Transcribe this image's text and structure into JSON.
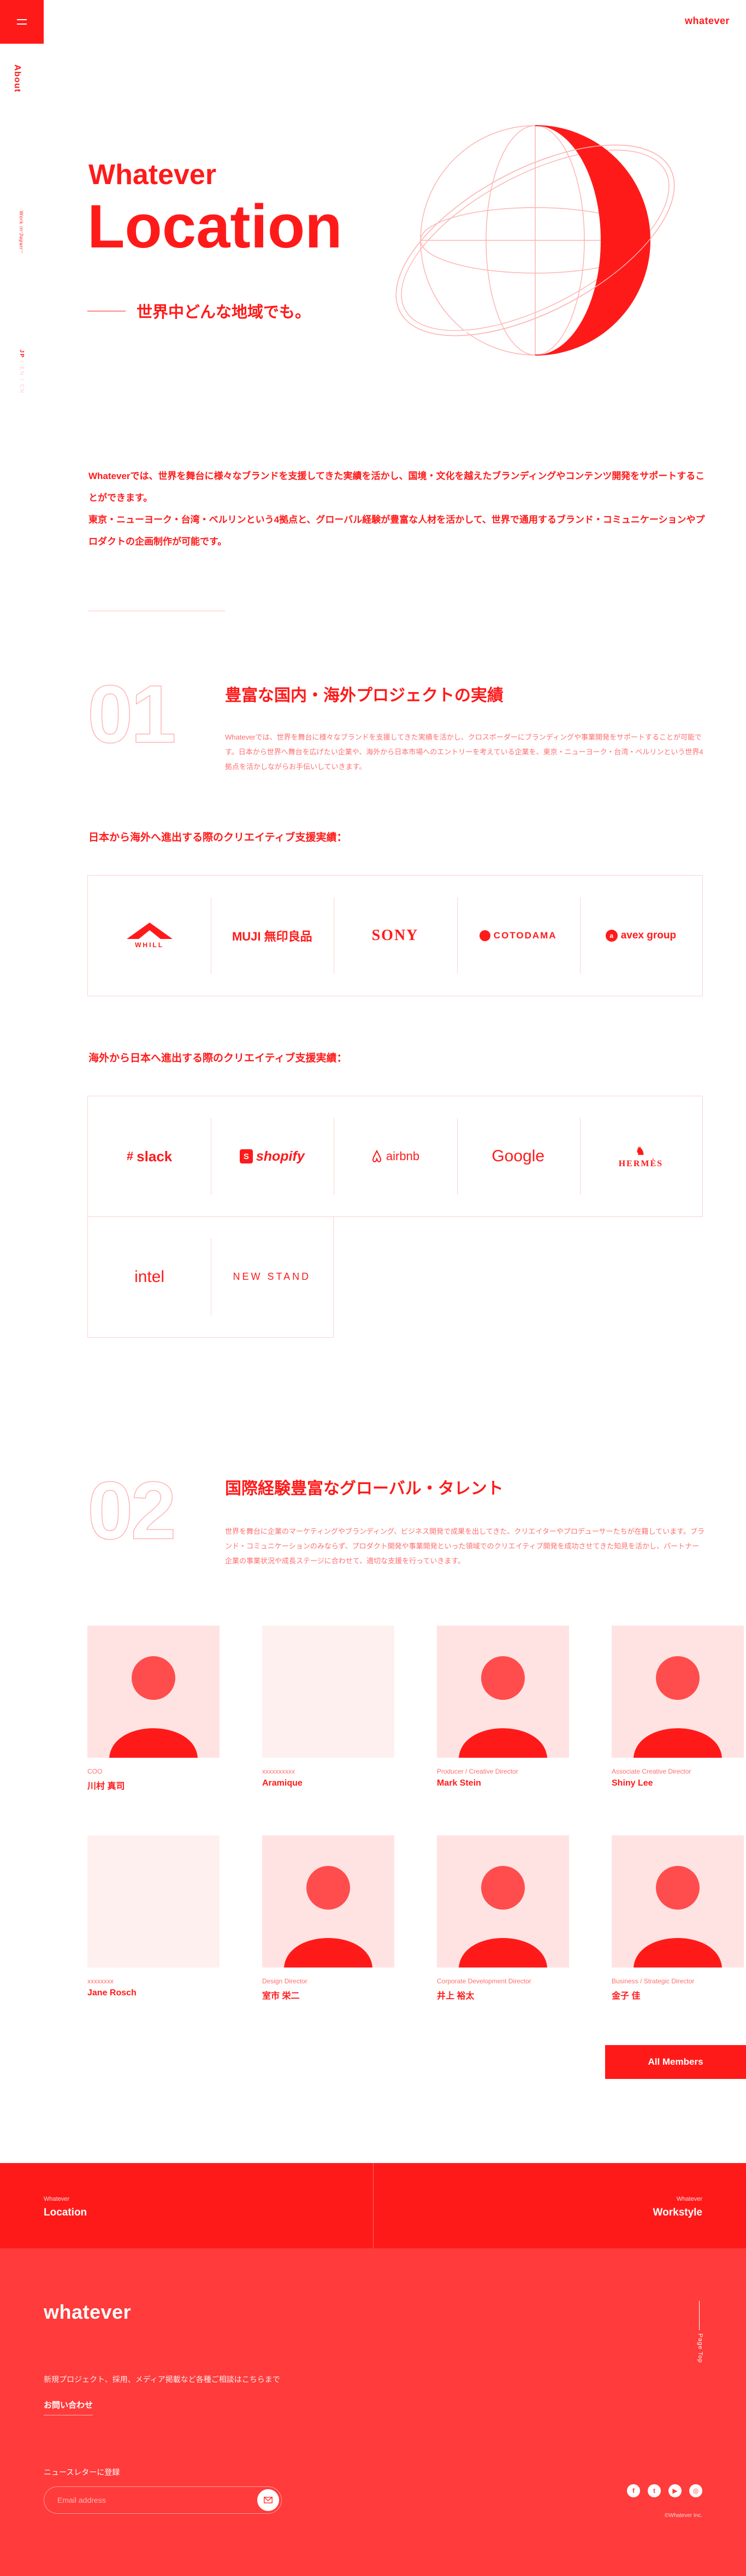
{
  "header": {
    "logo": "whatever",
    "menu_icon": "hamburger-icon"
  },
  "side": {
    "about": "About",
    "label": "Work in Japan",
    "lang": [
      "JP",
      "EN",
      "CN"
    ]
  },
  "hero": {
    "eyebrow": "Whatever",
    "title": "Location",
    "subtitle": "世界中どんな地域でも。"
  },
  "intro": {
    "line1": "Whateverでは、世界を舞台に様々なブランドを支援してきた実績を活かし、国境・文化を越えたブランディングやコンテンツ開発をサポートすることができます。",
    "line2": "東京・ニューヨーク・台湾・ベルリンという4拠点と、グローバル経験が豊富な人材を活かして、世界で通用するブランド・コミュニケーションやプロダクトの企画制作が可能です。"
  },
  "section1": {
    "num": "01",
    "title": "豊富な国内・海外プロジェクトの実績",
    "body": "Whateverでは、世界を舞台に様々なブランドを支援してきた実績を活かし、クロスボーダーにブランディングや事業開発をサポートすることが可能です。日本から世界へ舞台を広げたい企業や、海外から日本市場へのエントリーを考えている企業を、東京・ニューヨーク・台湾・ベルリンという世界4拠点を活かしながらお手伝いしていきます。",
    "jp_to_world_heading": "日本から海外へ進出する際のクリエイティブ支援実績：",
    "jp_to_world": [
      "WHILL",
      "MUJI 無印良品",
      "SONY",
      "COTODAMA",
      "avex group"
    ],
    "world_to_jp_heading": "海外から日本へ進出する際のクリエイティブ支援実績：",
    "world_to_jp": [
      "slack",
      "shopify",
      "airbnb",
      "Google",
      "HERMÈS",
      "intel",
      "NEW STAND"
    ]
  },
  "section2": {
    "num": "02",
    "title": "国際経験豊富なグローバル・タレント",
    "body": "世界を舞台に企業のマーケティングやブランディング、ビジネス開発で成果を出してきた、クリエイターやプロデューサーたちが在籍しています。ブランド・コミュニケーションのみならず、プロダクト開発や事業開発といった領域でのクリエイティブ開発を成功させてきた知見を活かし、パートナー企業の事業状況や成長ステージに合わせて、適切な支援を行っていきます。",
    "members": [
      {
        "role": "COO",
        "name": "川村 真司",
        "photo": true
      },
      {
        "role": "xxxxxxxxxx",
        "name": "Aramique",
        "photo": false
      },
      {
        "role": "Producer / Creative Director",
        "name": "Mark Stein",
        "photo": true
      },
      {
        "role": "Associate Creative Director",
        "name": "Shiny Lee",
        "photo": true
      },
      {
        "role": "xxxxxxxx",
        "name": "Jane Rosch",
        "photo": false
      },
      {
        "role": "Design Director",
        "name": "室市 栄二",
        "photo": true
      },
      {
        "role": "Corporate Development Director",
        "name": "井上 裕太",
        "photo": true
      },
      {
        "role": "Business / Strategic Director",
        "name": "金子 佳",
        "photo": true
      }
    ],
    "all_members": "All Members"
  },
  "footer_nav": [
    {
      "small": "Whatever",
      "big": "Location"
    },
    {
      "small": "Whatever",
      "big": "Workstyle"
    }
  ],
  "footer": {
    "logo": "whatever",
    "text": "新規プロジェクト、採用、メディア掲載など各種ご相談はこちらまで",
    "contact": "お問い合わせ",
    "news_label": "ニュースレターに登録",
    "email_placeholder": "Email address",
    "pagetop": "Page Top",
    "socials": [
      "facebook-icon",
      "twitter-icon",
      "youtube-icon",
      "instagram-icon"
    ],
    "copyright": "©Whatever Inc."
  },
  "colors": {
    "accent": "#ff1a1a",
    "footer_bg": "#ff3b3b"
  }
}
